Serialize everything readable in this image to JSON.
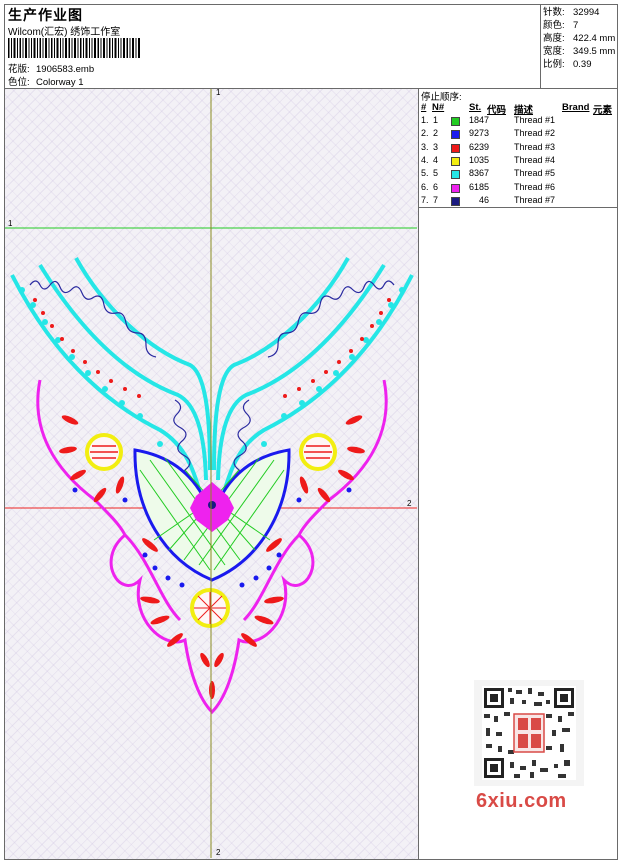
{
  "header": {
    "title": "生产作业图",
    "company": "Wilcom(汇宏) 绣饰工作室",
    "design_label": "花版:",
    "design_value": "1906583.emb",
    "colorway_label": "色位:",
    "colorway_value": "Colorway 1"
  },
  "stats": [
    {
      "label": "针数:",
      "value": "32994"
    },
    {
      "label": "颜色:",
      "value": "7"
    },
    {
      "label": "高度:",
      "value": "422.4 mm"
    },
    {
      "label": "宽度:",
      "value": "349.5 mm"
    },
    {
      "label": "比例:",
      "value": "0.39"
    }
  ],
  "stop_sequence": {
    "heading": "停止顺序:",
    "col_hash": "#",
    "col_n": "N#",
    "col_st": "St.",
    "col_code": "代码",
    "col_desc": "描述",
    "col_brand": "Brand",
    "col_element": "元素",
    "rows": [
      {
        "idx": "1.",
        "n": "1",
        "color": "#22cc22",
        "stitches": "1847",
        "desc": "Thread #1"
      },
      {
        "idx": "2.",
        "n": "2",
        "color": "#1a1aee",
        "stitches": "9273",
        "desc": "Thread #2"
      },
      {
        "idx": "3.",
        "n": "3",
        "color": "#ee1a1a",
        "stitches": "6239",
        "desc": "Thread #3"
      },
      {
        "idx": "4.",
        "n": "4",
        "color": "#f2ee10",
        "stitches": "1035",
        "desc": "Thread #4"
      },
      {
        "idx": "5.",
        "n": "5",
        "color": "#25e6e6",
        "stitches": "8367",
        "desc": "Thread #5"
      },
      {
        "idx": "6.",
        "n": "6",
        "color": "#ee22ee",
        "stitches": "6185",
        "desc": "Thread #6"
      },
      {
        "idx": "7.",
        "n": "7",
        "color": "#1a1a80",
        "stitches": "46",
        "desc": "Thread #7"
      }
    ]
  },
  "axes": {
    "v_top": "1",
    "v_bottom": "2",
    "h_left": "1",
    "h_right": "2"
  },
  "watermark": "6xiu.com"
}
